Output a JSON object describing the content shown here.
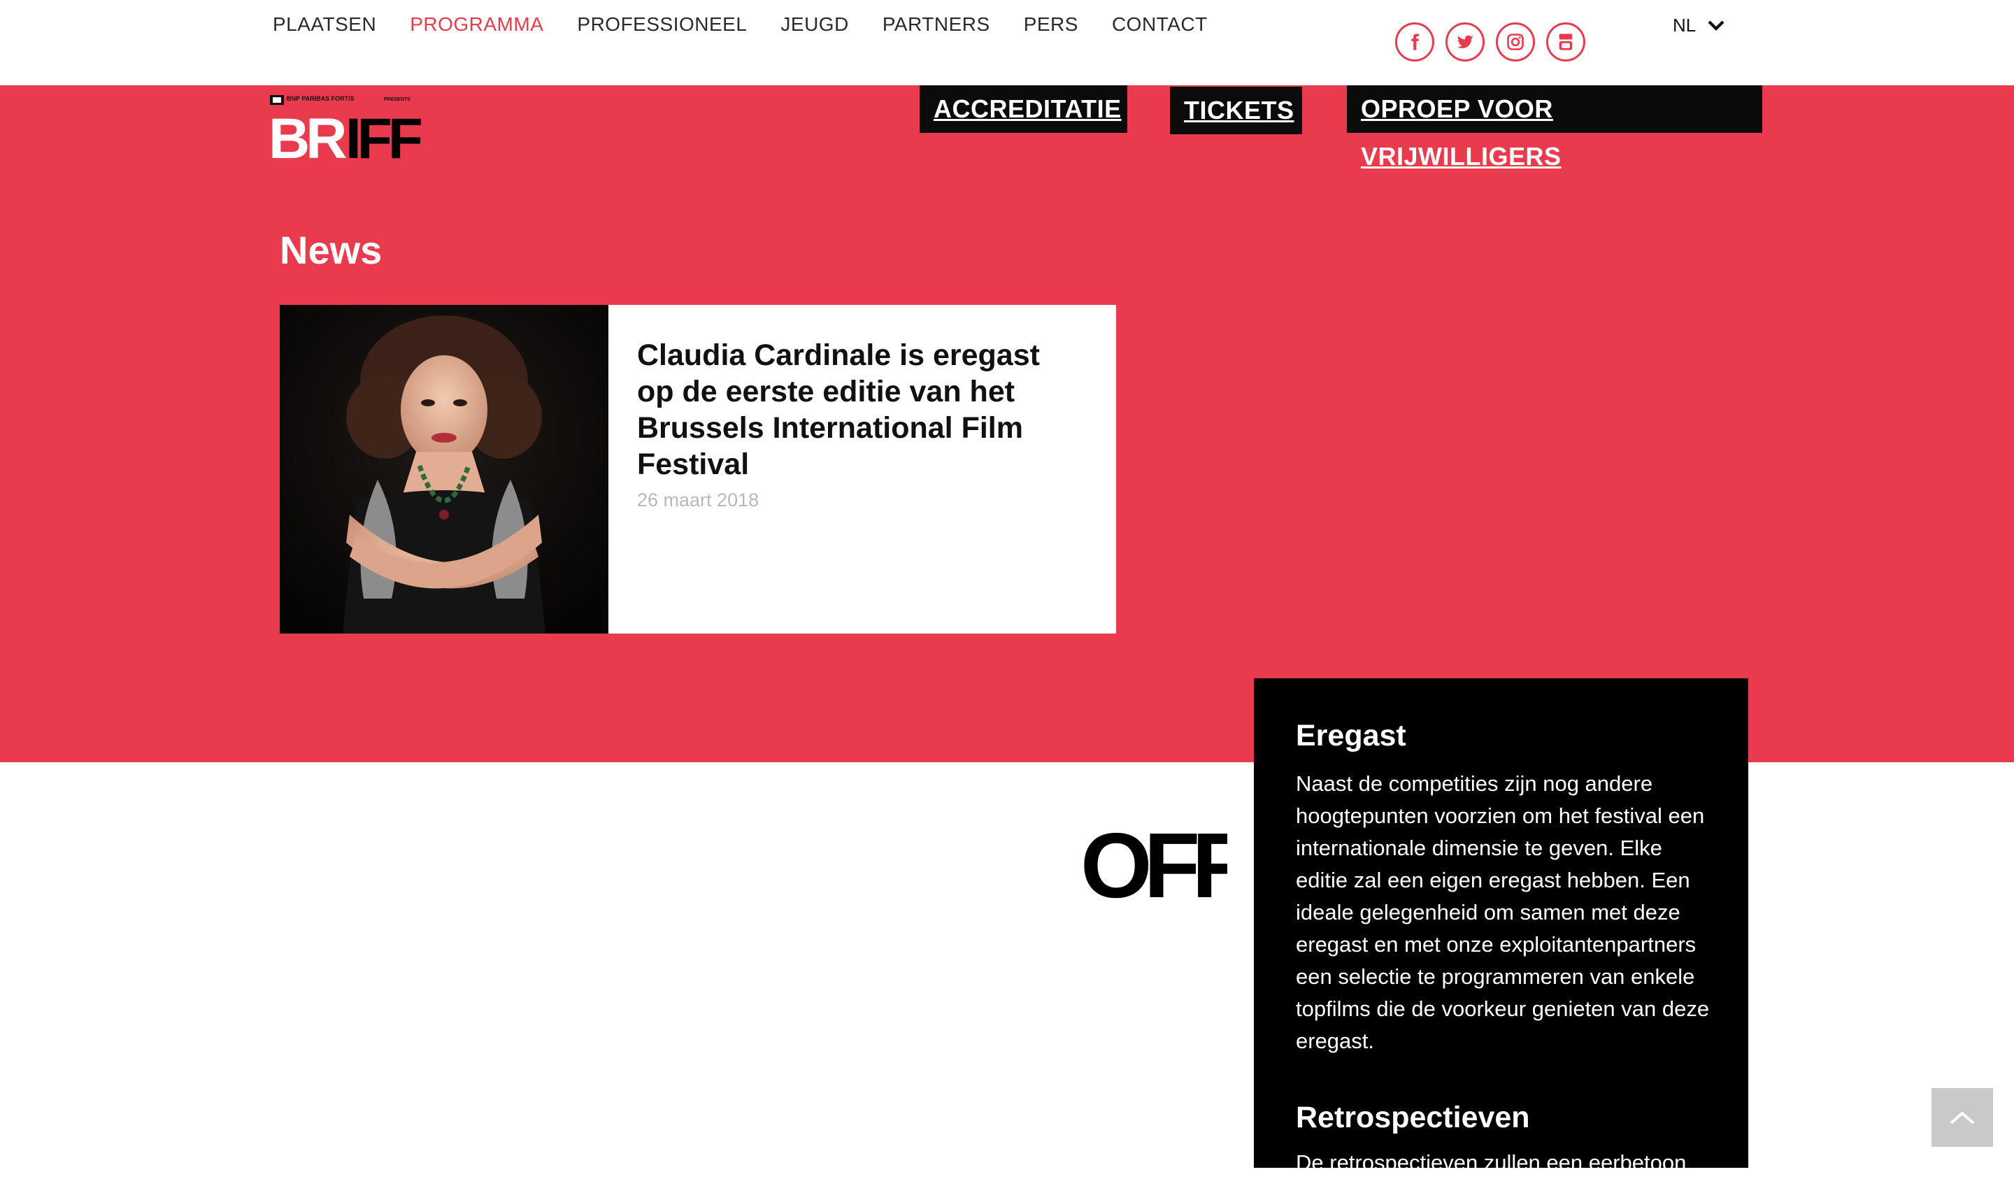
{
  "nav": {
    "items": [
      {
        "label": "PLAATSEN",
        "active": false
      },
      {
        "label": "PROGRAMMA",
        "active": true
      },
      {
        "label": "PROFESSIONEEL",
        "active": false
      },
      {
        "label": "JEUGD",
        "active": false
      },
      {
        "label": "PARTNERS",
        "active": false
      },
      {
        "label": "PERS",
        "active": false
      },
      {
        "label": "CONTACT",
        "active": false
      }
    ],
    "social_icons": [
      "facebook-icon",
      "twitter-icon",
      "instagram-icon",
      "youtube-icon"
    ],
    "language": "NL"
  },
  "brand": {
    "sponsor": "BNP PARIBAS FORTIS",
    "presents": "PRESENTS",
    "logo_text_left": "BR",
    "logo_text_right": "IFF"
  },
  "cta": {
    "accreditation": "ACCREDITATIE",
    "tickets": "TICKETS",
    "volunteers": "OPROEP VOOR VRIJWILLIGERS"
  },
  "news": {
    "section_title": "News",
    "articles": [
      {
        "headline": "Claudia Cardinale is eregast op de eerste editie van het Brussels International Film Festival",
        "date": "26 maart 2018"
      }
    ]
  },
  "off_logo_text": "OFF",
  "side_panel": {
    "sections": [
      {
        "title": "Eregast",
        "text": "Naast de competities zijn nog andere hoogtepunten voorzien om het festival een internationale dimensie te geven. Elke editie zal een eigen eregast hebben. Een ideale gelegenheid om samen met deze eregast en met onze exploitantenpartners een selectie te programmeren van enkele topfilms die de voorkeur genieten van deze eregast."
      },
      {
        "title": "Retrospectieven",
        "text": "De retrospectieven zullen een eerbetoon"
      }
    ]
  },
  "colors": {
    "brand_red": "#ea3b4e",
    "nav_active": "#e73c4e",
    "cta_bg": "#0b0b0b",
    "panel_bg": "#000000"
  }
}
